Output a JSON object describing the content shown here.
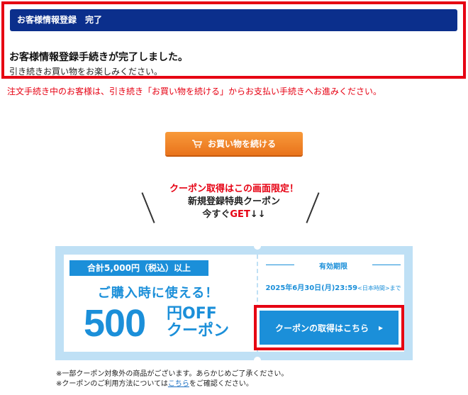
{
  "registration": {
    "header": "お客様情報登録　完了",
    "title": "お客様情報登録手続きが完了しました。",
    "subtitle": "引き続きお買い物をお楽しみください。"
  },
  "notice": "注文手続き中のお客様は、引き続き「お買い物を続ける」からお支払い手続きへお進みください。",
  "continue_button": {
    "label": "お買い物を続ける",
    "icon": "cart-icon"
  },
  "promo": {
    "line1": "クーポン取得はこの画面限定！",
    "line2": "新規登録特典クーポン",
    "line3_prefix": "今すぐ",
    "line3_get": "GET",
    "line3_arrows": "↓↓"
  },
  "coupon": {
    "condition": "合計5,000円（税込）以上",
    "usage": "ご購入時に使える！",
    "amount": "500",
    "unit_line1": "円OFF",
    "unit_line2": "クーポン",
    "validity_title": "有効期限",
    "validity_date": "2025年6月30日(月)23:59",
    "validity_tz": "<日本時間>まで",
    "get_button": "クーポンの取得はこちら",
    "get_button_arrow": "▸"
  },
  "footnotes": {
    "line1": "※一部クーポン対象外の商品がございます。あらかじめご了承ください。",
    "line2_prefix": "※クーポンのご利用方法については",
    "line2_link": "こちら",
    "line2_suffix": "をご確認ください。"
  },
  "colors": {
    "accent_blue": "#1b8fd9",
    "header_navy": "#0b2f8c",
    "alert_red": "#e60012",
    "orange": "#f08a2c"
  }
}
